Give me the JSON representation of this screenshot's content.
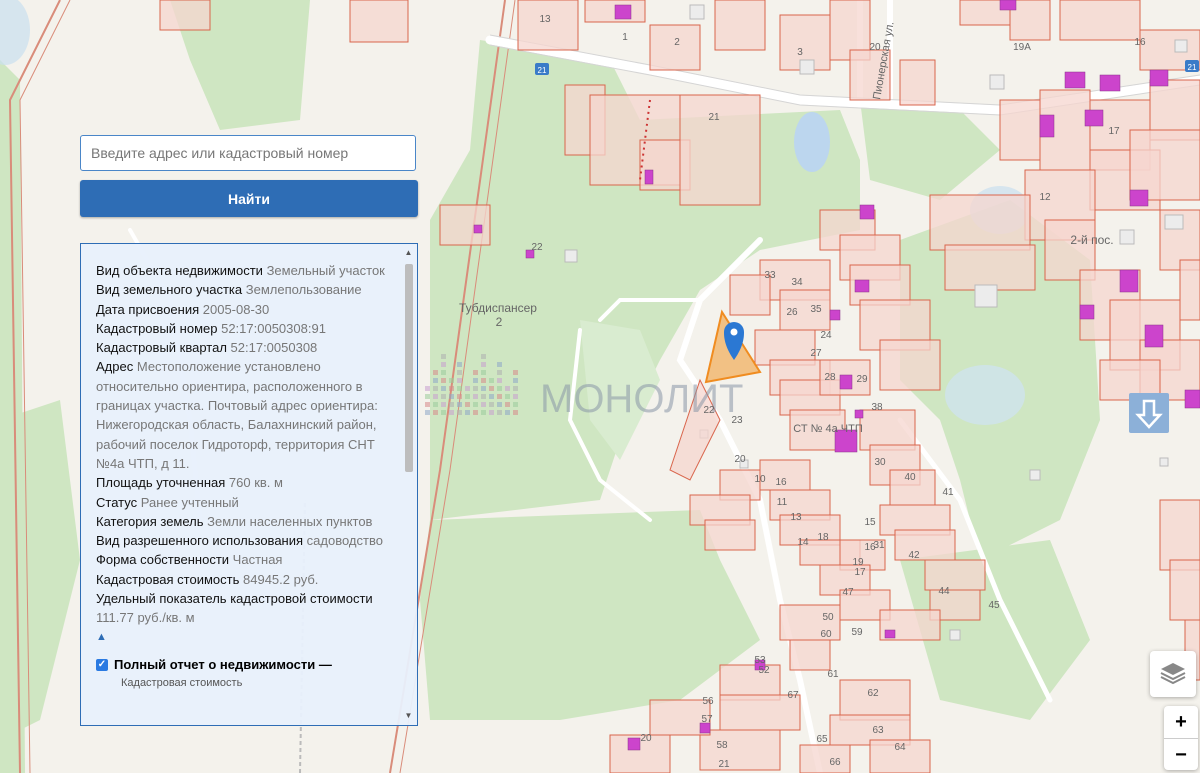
{
  "search": {
    "placeholder": "Введите адрес или кадастровый номер",
    "button": "Найти"
  },
  "info": [
    {
      "label": "Вид объекта недвижимости",
      "value": "Земельный участок"
    },
    {
      "label": "Вид земельного участка",
      "value": "Землепользование"
    },
    {
      "label": "Дата присвоения",
      "value": "2005-08-30"
    },
    {
      "label": "Кадастровый номер",
      "value": "52:17:0050308:91"
    },
    {
      "label": "Кадастровый квартал",
      "value": "52:17:0050308"
    },
    {
      "label": "Адрес",
      "value": "Местоположение установлено относительно ориентира, расположенного в границах участка. Почтовый адрес ориентира: Нижегородская область, Балахнинский район, рабочий поселок Гидроторф, территория СНТ №4а ЧТП, д 11."
    },
    {
      "label": "Площадь уточненная",
      "value": "760 кв. м"
    },
    {
      "label": "Статус",
      "value": "Ранее учтенный"
    },
    {
      "label": "Категория земель",
      "value": "Земли населенных пунктов"
    },
    {
      "label": "Вид разрешенного использования",
      "value": "садоводство"
    },
    {
      "label": "Форма собственности",
      "value": "Частная"
    },
    {
      "label": "Кадастровая стоимость",
      "value": "84945.2 руб."
    },
    {
      "label": "Удельный показатель кадастровой стоимости",
      "value": "111.77 руб./кв. м"
    }
  ],
  "collapse_glyph": "▲",
  "report": {
    "label": "Полный отчет о недвижимости —",
    "sublabel": "Кадастровая стоимость"
  },
  "map": {
    "watermark": "МОНОЛИТ",
    "place_labels": [
      "Тубдиспансер",
      "2",
      "СТ № 4а ЧТП",
      "2-й пос.",
      "Пионерская ул."
    ],
    "road_badges": [
      "21",
      "21"
    ],
    "house_numbers": [
      "13",
      "1",
      "2",
      "3",
      "20",
      "21",
      "19А",
      "16",
      "17",
      "12",
      "22",
      "33",
      "34",
      "35",
      "24",
      "26",
      "27",
      "28",
      "29",
      "38",
      "30",
      "40",
      "41",
      "42",
      "44",
      "45",
      "20",
      "16",
      "18",
      "19",
      "31",
      "47",
      "50",
      "59",
      "60",
      "61",
      "62",
      "63",
      "64",
      "65",
      "66",
      "67",
      "52",
      "53",
      "56",
      "57",
      "58",
      "21",
      "22",
      "23",
      "20",
      "10",
      "11",
      "13",
      "14",
      "15",
      "16",
      "17",
      "19"
    ],
    "colors": {
      "parcel_fill": "#f6d6cf",
      "parcel_border": "#d9654c",
      "building": "#cc33cc",
      "green": "#c9e8be",
      "forest": "#cfe8c4",
      "selected_parcel": "#f0a040",
      "water": "#bcd6ee",
      "marker": "#2b78d3"
    }
  },
  "controls": {
    "zoom_in": "+",
    "zoom_out": "−",
    "layers_icon": "layers-icon",
    "down_icon": "arrow-down-icon"
  }
}
